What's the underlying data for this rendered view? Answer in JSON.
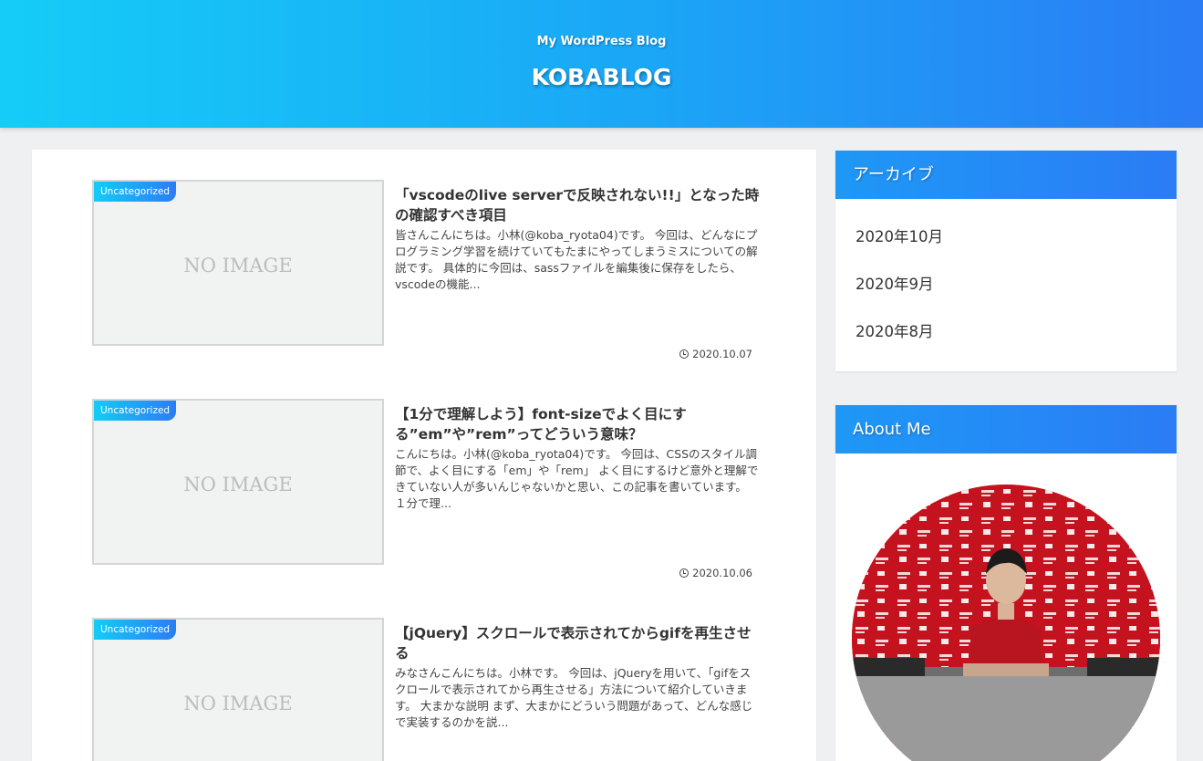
{
  "header": {
    "tagline": "My WordPress Blog",
    "site_title": "KOBABLOG"
  },
  "posts": [
    {
      "category": "Uncategorized",
      "thumbnail_text": "NO IMAGE",
      "title": "「vscodeのlive serverで反映されない!!」となった時の確認すべき項目",
      "excerpt": "皆さんこんにちは。小林(@koba_ryota04)です。 今回は、どんなにプログラミング学習を続けていてもたまにやってしまうミスについての解説です。 具体的に今回は、sassファイルを編集後に保存をしたら、vscodeの機能...",
      "date": "2020.10.07"
    },
    {
      "category": "Uncategorized",
      "thumbnail_text": "NO IMAGE",
      "title": "【1分で理解しよう】font-sizeでよく目にする”em”や”rem”ってどういう意味？",
      "excerpt": "こんにちは。小林(@koba_ryota04)です。 今回は、CSSのスタイル調節で、よく目にする「em」や「rem」 よく目にするけど意外と理解できていない人が多いんじゃないかと思い、この記事を書いています。 １分で理...",
      "date": "2020.10.06"
    },
    {
      "category": "Uncategorized",
      "thumbnail_text": "NO IMAGE",
      "title": "【jQuery】スクロールで表示されてからgifを再生させる",
      "excerpt": "みなさんこんにちは。小林です。 今回は、jQueryを用いて、「gifをスクロールで表示されてから再生させる」方法について紹介していきます。 大まかな説明 まず、大まかにどういう問題があって、どんな感じで実装するのかを説...",
      "date": ""
    }
  ],
  "sidebar": {
    "archive": {
      "title": "アーカイブ",
      "items": [
        "2020年10月",
        "2020年9月",
        "2020年8月"
      ]
    },
    "about": {
      "title": "About Me"
    }
  },
  "colors": {
    "header_gradient_start": "#15ccf7",
    "header_gradient_end": "#2b7cf5",
    "widget_head": "#2b7cf5",
    "background": "#eef0f2"
  }
}
